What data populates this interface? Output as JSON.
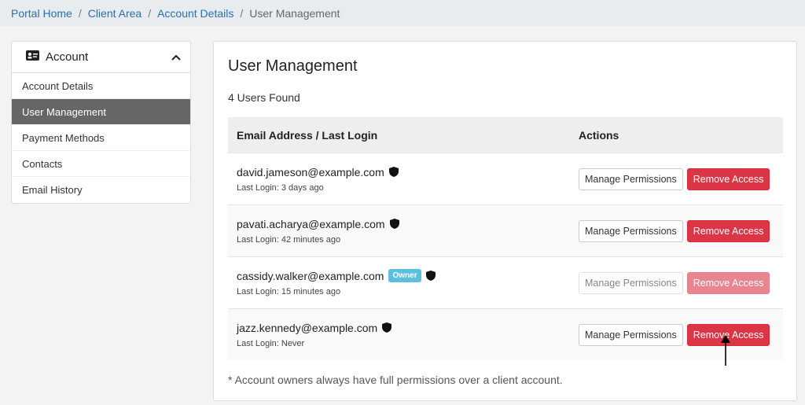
{
  "breadcrumb": {
    "items": [
      "Portal Home",
      "Client Area",
      "Account Details"
    ],
    "current": "User Management",
    "separator": "/"
  },
  "sidebar": {
    "header": "Account",
    "header_icon": "id-card-icon",
    "collapse_icon": "chevron-up-icon",
    "items": [
      {
        "label": "Account Details"
      },
      {
        "label": "User Management",
        "active": true
      },
      {
        "label": "Payment Methods"
      },
      {
        "label": "Contacts"
      },
      {
        "label": "Email History"
      }
    ]
  },
  "main": {
    "title": "User Management",
    "users_found": "4 Users Found",
    "columns": {
      "email": "Email Address / Last Login",
      "actions": "Actions"
    },
    "users": [
      {
        "email": "david.jameson@example.com",
        "last_login": "Last Login: 3 days ago",
        "owner": false,
        "disabled": false
      },
      {
        "email": "pavati.acharya@example.com",
        "last_login": "Last Login: 42 minutes ago",
        "owner": false,
        "disabled": false
      },
      {
        "email": "cassidy.walker@example.com",
        "last_login": "Last Login: 15 minutes ago",
        "owner": true,
        "disabled": true
      },
      {
        "email": "jazz.kennedy@example.com",
        "last_login": "Last Login: Never",
        "owner": false,
        "disabled": false
      }
    ],
    "owner_badge": "Owner",
    "manage_label": "Manage Permissions",
    "remove_label": "Remove Access",
    "footnote": "* Account owners always have full permissions over a client account."
  },
  "colors": {
    "danger": "#dc3545",
    "owner_badge": "#5bc0de",
    "active_nav": "#666666",
    "link": "#2a6fb0"
  }
}
